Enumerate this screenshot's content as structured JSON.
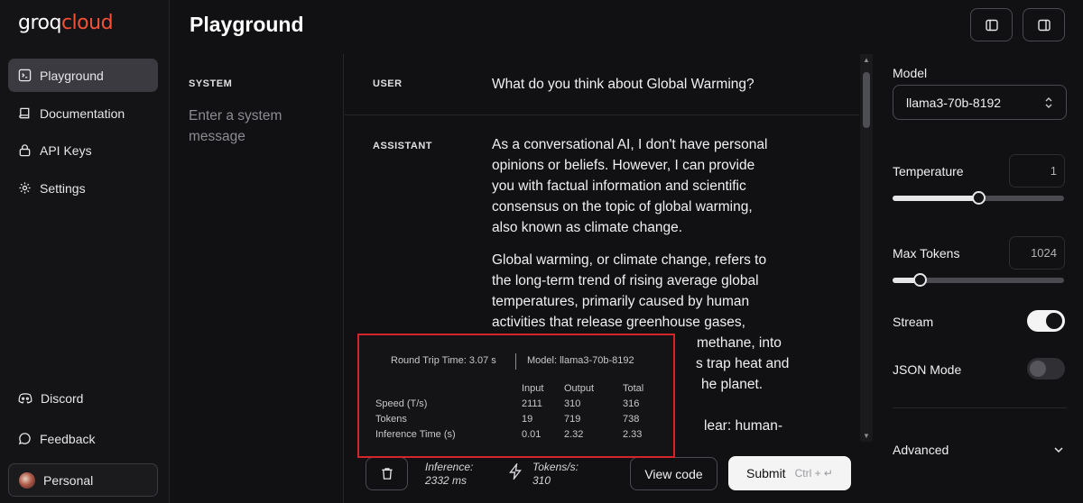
{
  "brand": {
    "part1": "groq",
    "part2": "cloud"
  },
  "sidebar": {
    "items": [
      {
        "label": "Playground",
        "icon": "terminal-icon"
      },
      {
        "label": "Documentation",
        "icon": "book-icon"
      },
      {
        "label": "API Keys",
        "icon": "lock-icon"
      },
      {
        "label": "Settings",
        "icon": "gear-icon"
      }
    ],
    "bottom": [
      {
        "label": "Discord",
        "icon": "discord-icon"
      },
      {
        "label": "Feedback",
        "icon": "chat-bubble-icon"
      }
    ],
    "account": {
      "label": "Personal"
    }
  },
  "header": {
    "title": "Playground"
  },
  "system": {
    "label": "SYSTEM",
    "placeholder": "Enter a system message"
  },
  "chat": {
    "user_label": "USER",
    "user_message": "What do you think about Global Warming?",
    "assistant_label": "ASSISTANT",
    "assistant_lines": [
      "As a conversational AI, I don't have personal",
      "opinions or beliefs. However, I can provide",
      "you with factual information and scientific",
      "consensus on the topic of global warming,",
      "also known as climate change.",
      "",
      "Global warming, or climate change, refers to",
      "the long-term trend of rising average global",
      "temperatures, primarily caused by human",
      "activities that release greenhouse gases,",
      "methane, into",
      "s trap heat and",
      "he planet.",
      "",
      "lear: human-"
    ]
  },
  "stats_overlay": {
    "round_trip": "Round Trip Time: 3.07 s",
    "model": "Model: llama3-70b-8192",
    "columns": [
      "Input",
      "Output",
      "Total"
    ],
    "rows": [
      {
        "label": "Speed (T/s)",
        "values": [
          "2111",
          "310",
          "316"
        ]
      },
      {
        "label": "Tokens",
        "values": [
          "19",
          "719",
          "738"
        ]
      },
      {
        "label": "Inference Time (s)",
        "values": [
          "0.01",
          "2.32",
          "2.33"
        ]
      }
    ]
  },
  "bottom_bar": {
    "inference_label": "Inference:",
    "inference_value": "2332 ms",
    "tokens_label": "Tokens/s:",
    "tokens_value": "310",
    "view_code": "View code",
    "submit": "Submit",
    "shortcut": "Ctrl + ↵"
  },
  "settings": {
    "model_label": "Model",
    "model_value": "llama3-70b-8192",
    "temperature_label": "Temperature",
    "temperature_value": "1",
    "temperature_fraction": 0.5,
    "max_tokens_label": "Max Tokens",
    "max_tokens_value": "1024",
    "max_tokens_fraction": 0.16,
    "stream_label": "Stream",
    "stream_on": true,
    "json_label": "JSON Mode",
    "json_on": false,
    "advanced_label": "Advanced"
  },
  "colors": {
    "brand_accent": "#f55036",
    "highlight_border": "#d3262b",
    "active_nav": "#3a3a40"
  }
}
